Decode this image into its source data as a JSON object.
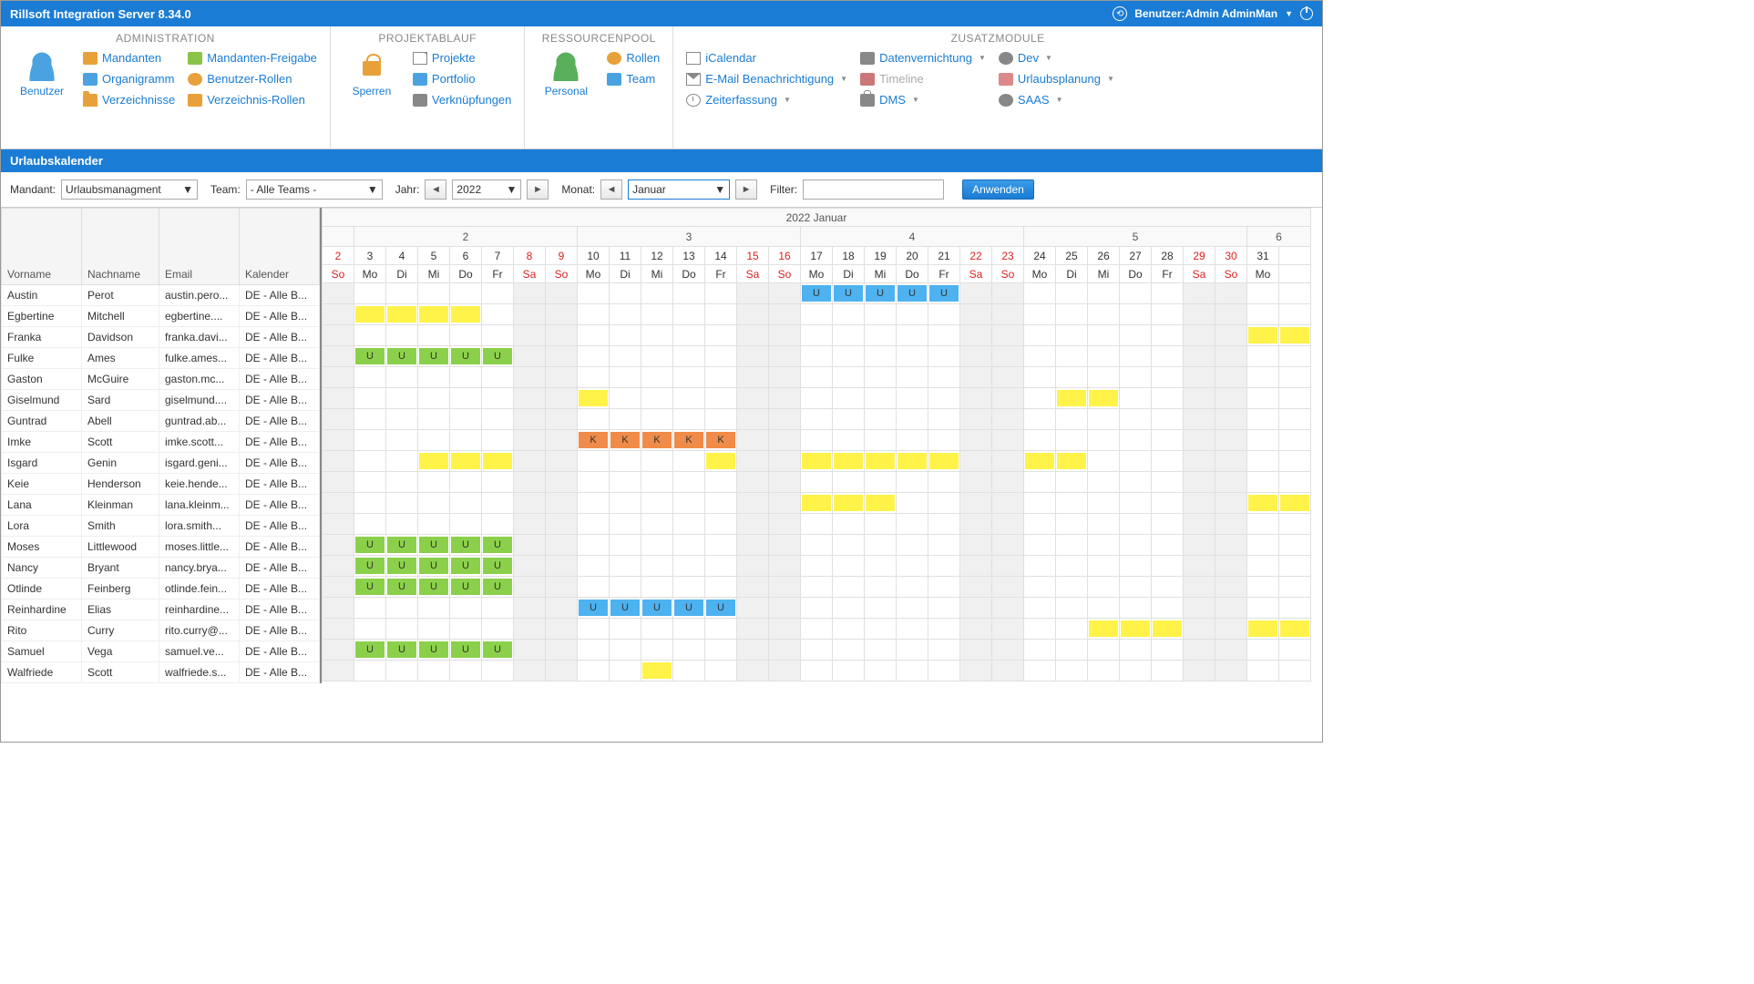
{
  "app_title": "Rillsoft Integration Server 8.34.0",
  "user_label": "Benutzer:Admin AdminMan",
  "ribbon": {
    "groups": [
      {
        "title": "ADMINISTRATION",
        "big": "Benutzer"
      },
      {
        "title": "PROJEKTABLAUF",
        "big": "Sperren"
      },
      {
        "title": "RESSOURCENPOOL",
        "big": "Personal"
      },
      {
        "title": "ZUSATZMODULE"
      }
    ],
    "admin_col1": [
      "Mandanten",
      "Organigramm",
      "Verzeichnisse"
    ],
    "admin_col2": [
      "Mandanten-Freigabe",
      "Benutzer-Rollen",
      "Verzeichnis-Rollen"
    ],
    "proj_col": [
      "Projekte",
      "Portfolio",
      "Verknüpfungen"
    ],
    "res_col": [
      "Rollen",
      "Team"
    ],
    "zus_col1": [
      "iCalendar",
      "E-Mail Benachrichtigung",
      "Zeiterfassung"
    ],
    "zus_col2": [
      "Datenvernichtung",
      "Timeline",
      "DMS"
    ],
    "zus_col3": [
      "Dev",
      "Urlaubsplanung",
      "SAAS"
    ]
  },
  "subheader": "Urlaubskalender",
  "toolbar": {
    "mandant_label": "Mandant:",
    "mandant_value": "Urlaubsmanagment",
    "team_label": "Team:",
    "team_value": "- Alle Teams -",
    "jahr_label": "Jahr:",
    "jahr_value": "2022",
    "monat_label": "Monat:",
    "monat_value": "Januar",
    "filter_label": "Filter:",
    "filter_value": "",
    "apply": "Anwenden"
  },
  "grid_headers": [
    "Vorname",
    "Nachname",
    "Email",
    "Kalender"
  ],
  "employees": [
    {
      "vn": "Austin",
      "nn": "Perot",
      "em": "austin.pero...",
      "kal": "DE - Alle B..."
    },
    {
      "vn": "Egbertine",
      "nn": "Mitchell",
      "em": "egbertine....",
      "kal": "DE - Alle B..."
    },
    {
      "vn": "Franka",
      "nn": "Davidson",
      "em": "franka.davi...",
      "kal": "DE - Alle B..."
    },
    {
      "vn": "Fulke",
      "nn": "Ames",
      "em": "fulke.ames...",
      "kal": "DE - Alle B..."
    },
    {
      "vn": "Gaston",
      "nn": "McGuire",
      "em": "gaston.mc...",
      "kal": "DE - Alle B..."
    },
    {
      "vn": "Giselmund",
      "nn": "Sard",
      "em": "giselmund....",
      "kal": "DE - Alle B..."
    },
    {
      "vn": "Guntrad",
      "nn": "Abell",
      "em": "guntrad.ab...",
      "kal": "DE - Alle B..."
    },
    {
      "vn": "Imke",
      "nn": "Scott",
      "em": "imke.scott...",
      "kal": "DE - Alle B..."
    },
    {
      "vn": "Isgard",
      "nn": "Genin",
      "em": "isgard.geni...",
      "kal": "DE - Alle B..."
    },
    {
      "vn": "Keie",
      "nn": "Henderson",
      "em": "keie.hende...",
      "kal": "DE - Alle B..."
    },
    {
      "vn": "Lana",
      "nn": "Kleinman",
      "em": "lana.kleinm...",
      "kal": "DE - Alle B..."
    },
    {
      "vn": "Lora",
      "nn": "Smith",
      "em": "lora.smith...",
      "kal": "DE - Alle B..."
    },
    {
      "vn": "Moses",
      "nn": "Littlewood",
      "em": "moses.little...",
      "kal": "DE - Alle B..."
    },
    {
      "vn": "Nancy",
      "nn": "Bryant",
      "em": "nancy.brya...",
      "kal": "DE - Alle B..."
    },
    {
      "vn": "Otlinde",
      "nn": "Feinberg",
      "em": "otlinde.fein...",
      "kal": "DE - Alle B..."
    },
    {
      "vn": "Reinhardine",
      "nn": "Elias",
      "em": "reinhardine...",
      "kal": "DE - Alle B..."
    },
    {
      "vn": "Rito",
      "nn": "Curry",
      "em": "rito.curry@...",
      "kal": "DE - Alle B..."
    },
    {
      "vn": "Samuel",
      "nn": "Vega",
      "em": "samuel.ve...",
      "kal": "DE - Alle B..."
    },
    {
      "vn": "Walfriede",
      "nn": "Scott",
      "em": "walfriede.s...",
      "kal": "DE - Alle B..."
    }
  ],
  "calendar": {
    "month_title": "2022 Januar",
    "weeks": [
      "",
      "2",
      "3",
      "4",
      "5",
      "6"
    ],
    "week_spans": [
      1,
      7,
      7,
      7,
      7,
      2
    ],
    "days": [
      2,
      3,
      4,
      5,
      6,
      7,
      8,
      9,
      10,
      11,
      12,
      13,
      14,
      15,
      16,
      17,
      18,
      19,
      20,
      21,
      22,
      23,
      24,
      25,
      26,
      27,
      28,
      29,
      30,
      31
    ],
    "dow": [
      "So",
      "Mo",
      "Di",
      "Mi",
      "Do",
      "Fr",
      "Sa",
      "So",
      "Mo",
      "Di",
      "Mi",
      "Do",
      "Fr",
      "Sa",
      "So",
      "Mo",
      "Di",
      "Mi",
      "Do",
      "Fr",
      "Sa",
      "So",
      "Mo",
      "Di",
      "Mi",
      "Do",
      "Fr",
      "Sa",
      "So",
      "Mo"
    ],
    "weekend_idx": [
      0,
      6,
      7,
      13,
      14,
      20,
      21,
      27,
      28
    ],
    "red_idx": [
      0,
      6,
      7,
      13,
      14,
      20,
      21,
      27,
      28
    ],
    "entries": {
      "0": [
        {
          "from": 15,
          "to": 19,
          "type": "Ublue",
          "label": "U"
        }
      ],
      "1": [
        {
          "from": 1,
          "to": 4,
          "type": "Y",
          "label": ""
        }
      ],
      "2": [
        {
          "from": 29,
          "to": 30,
          "type": "Y",
          "label": ""
        }
      ],
      "3": [
        {
          "from": 1,
          "to": 5,
          "type": "U",
          "label": "U"
        }
      ],
      "5": [
        {
          "from": 8,
          "to": 8,
          "type": "Y",
          "label": ""
        },
        {
          "from": 23,
          "to": 24,
          "type": "Y",
          "label": ""
        }
      ],
      "7": [
        {
          "from": 8,
          "to": 12,
          "type": "K",
          "label": "K"
        }
      ],
      "8": [
        {
          "from": 3,
          "to": 5,
          "type": "Y",
          "label": ""
        },
        {
          "from": 12,
          "to": 12,
          "type": "Y",
          "label": ""
        },
        {
          "from": 15,
          "to": 19,
          "type": "Y",
          "label": ""
        },
        {
          "from": 22,
          "to": 23,
          "type": "Y",
          "label": ""
        }
      ],
      "10": [
        {
          "from": 15,
          "to": 17,
          "type": "Y",
          "label": ""
        },
        {
          "from": 29,
          "to": 30,
          "type": "Y",
          "label": ""
        }
      ],
      "12": [
        {
          "from": 1,
          "to": 5,
          "type": "U",
          "label": "U"
        }
      ],
      "13": [
        {
          "from": 1,
          "to": 5,
          "type": "U",
          "label": "U"
        }
      ],
      "14": [
        {
          "from": 1,
          "to": 5,
          "type": "U",
          "label": "U"
        }
      ],
      "15": [
        {
          "from": 8,
          "to": 12,
          "type": "Ublue",
          "label": "U"
        }
      ],
      "16": [
        {
          "from": 24,
          "to": 26,
          "type": "Y",
          "label": ""
        },
        {
          "from": 29,
          "to": 30,
          "type": "Y",
          "label": ""
        }
      ],
      "17": [
        {
          "from": 1,
          "to": 5,
          "type": "U",
          "label": "U"
        }
      ],
      "18": [
        {
          "from": 10,
          "to": 10,
          "type": "Y",
          "label": ""
        }
      ]
    }
  }
}
